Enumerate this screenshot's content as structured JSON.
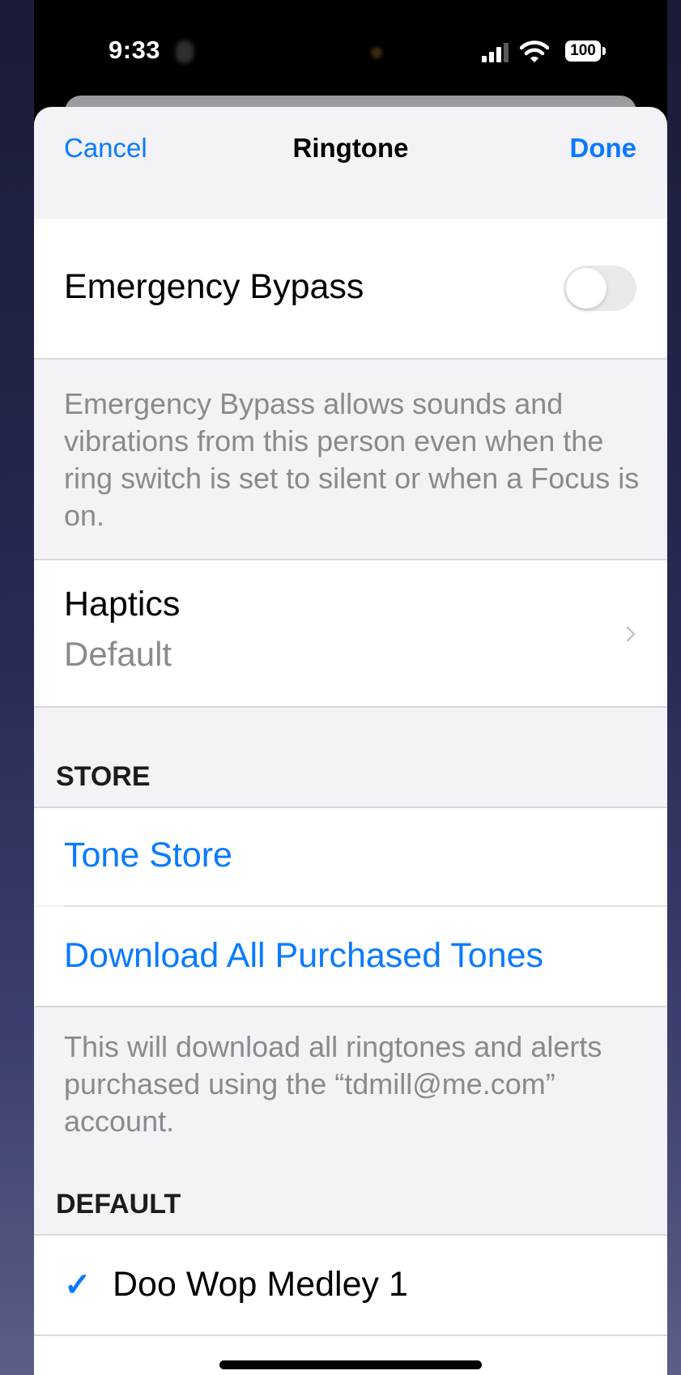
{
  "status_bar": {
    "time": "9:33",
    "battery": "100"
  },
  "nav": {
    "cancel_label": "Cancel",
    "title": "Ringtone",
    "done_label": "Done"
  },
  "emergency_bypass": {
    "label": "Emergency Bypass",
    "enabled": false,
    "footer": "Emergency Bypass allows sounds and vibrations from this person even when the ring switch is set to silent or when a Focus is on."
  },
  "haptics": {
    "label": "Haptics",
    "value": "Default"
  },
  "store": {
    "header": "STORE",
    "tone_store_label": "Tone Store",
    "download_label": "Download All Purchased Tones",
    "footer": "This will download all ringtones and alerts purchased using the “tdmill@me.com” account."
  },
  "default_section": {
    "header": "DEFAULT",
    "selected_tone": "Doo Wop Medley 1",
    "check_glyph": "✓"
  },
  "colors": {
    "accent": "#0a7aff",
    "background": "#f2f2f7",
    "secondary_text": "#8a8a8e"
  },
  "icons": [
    "signal-icon",
    "wifi-icon",
    "battery-icon",
    "chevron-right-icon",
    "checkmark-icon"
  ]
}
